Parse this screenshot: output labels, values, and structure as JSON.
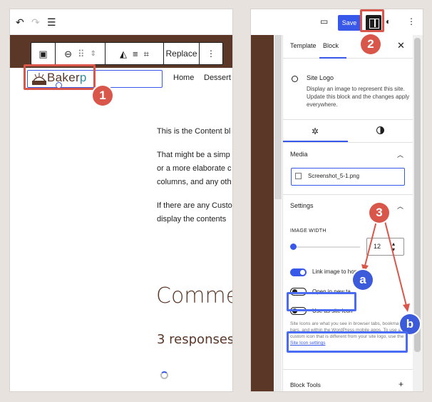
{
  "left_panel": {
    "nav": [
      "Home",
      "Dessert"
    ],
    "logo_text": "Baker",
    "logo_text_accent": "p",
    "toolbar": {
      "replace_label": "Replace"
    },
    "content_lines": [
      "This is the Content bl",
      "That might be a simp",
      "or a more elaborate c",
      "columns, and any oth",
      "If there are any Custo",
      "display the contents"
    ],
    "comments_heading": "Comme",
    "responses_text": "3 responses"
  },
  "right_panel": {
    "save_label": "Save",
    "tabs": [
      "Template",
      "Block"
    ],
    "block_title": "Site Logo",
    "block_description": "Display an image to represent this site. Update this block and the changes apply everywhere.",
    "media_section": "Media",
    "media_file": "Screenshot_5-1.png",
    "settings_section": "Settings",
    "image_width_label": "IMAGE WIDTH",
    "image_width_value": "12",
    "toggles": [
      {
        "label": "Link image to hom",
        "on": true
      },
      {
        "label": "Open in new ta",
        "on": false
      },
      {
        "label": "Use as site icon",
        "on": false
      }
    ],
    "help_text": "Site Icons are what you see in browser tabs, bookmark bars, and within the WordPress mobile apps. To use a custom icon that is different from your site logo, use the ",
    "help_link": "Site Icon settings",
    "block_tools": "Block Tools"
  },
  "annotations": {
    "badge_1": "1",
    "badge_2": "2",
    "badge_3": "3",
    "badge_a": "a",
    "badge_b": "b",
    "red_color": "#d9574a",
    "blue_color": "#4a6cf2"
  }
}
